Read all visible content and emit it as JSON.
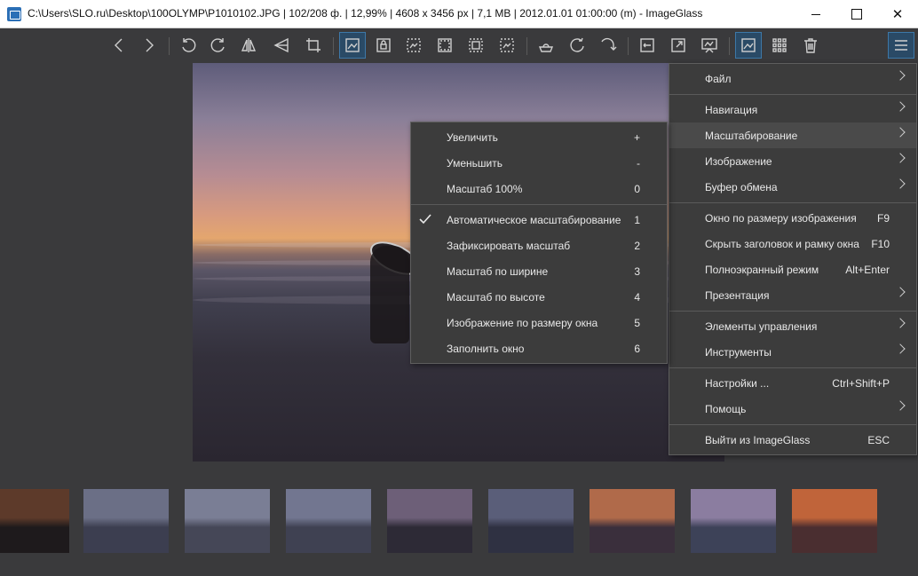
{
  "window": {
    "title": "C:\\Users\\SLO.ru\\Desktop\\100OLYMP\\P1010102.JPG  |  102/208 ф.  |  12,99%  |  4608 x 3456 px  |  7,1 MB  |  2012.01.01 01:00:00 (m)  - ImageGlass",
    "close_glyph": "✕"
  },
  "toolbar": {
    "buttons": [
      "previous-image",
      "next-image",
      "rotate-left",
      "rotate-right",
      "flip-horizontal",
      "flip-vertical",
      "crop",
      "auto-zoom",
      "lock-zoom",
      "scale-to-width",
      "scale-to-height",
      "scale-to-fit",
      "scale-to-fill",
      "open-with",
      "refresh",
      "goto",
      "window-fit",
      "fullscreen",
      "slideshow",
      "thumbnail-bar",
      "grid",
      "delete",
      "main-menu"
    ],
    "active": [
      "auto-zoom",
      "thumbnail-bar",
      "main-menu"
    ]
  },
  "main_menu": {
    "items": [
      {
        "label": "Файл",
        "submenu": true
      },
      {
        "sep": true
      },
      {
        "label": "Навигация",
        "submenu": true
      },
      {
        "label": "Масштабирование",
        "submenu": true,
        "hover": true
      },
      {
        "label": "Изображение",
        "submenu": true
      },
      {
        "label": "Буфер обмена",
        "submenu": true
      },
      {
        "sep": true
      },
      {
        "label": "Окно по размеру изображения",
        "shortcut": "F9"
      },
      {
        "label": "Скрыть заголовок и рамку окна",
        "shortcut": "F10"
      },
      {
        "label": "Полноэкранный режим",
        "shortcut": "Alt+Enter"
      },
      {
        "label": "Презентация",
        "submenu": true
      },
      {
        "sep": true
      },
      {
        "label": "Элементы управления",
        "submenu": true
      },
      {
        "label": "Инструменты",
        "submenu": true
      },
      {
        "sep": true
      },
      {
        "label": "Настройки ...",
        "shortcut": "Ctrl+Shift+P"
      },
      {
        "label": "Помощь",
        "submenu": true
      },
      {
        "sep": true
      },
      {
        "label": "Выйти из ImageGlass",
        "shortcut": "ESC"
      }
    ]
  },
  "zoom_menu": {
    "items": [
      {
        "label": "Увеличить",
        "shortcut": "+"
      },
      {
        "label": "Уменьшить",
        "shortcut": "-"
      },
      {
        "label": "Масштаб 100%",
        "shortcut": "0"
      },
      {
        "sep": true
      },
      {
        "label": "Автоматическое масштабирование",
        "shortcut": "1",
        "checked": true
      },
      {
        "label": "Зафиксировать масштаб",
        "shortcut": "2"
      },
      {
        "label": "Масштаб по ширине",
        "shortcut": "3"
      },
      {
        "label": "Масштаб по высоте",
        "shortcut": "4"
      },
      {
        "label": "Изображение по размеру окна",
        "shortcut": "5"
      },
      {
        "label": "Заполнить окно",
        "shortcut": "6"
      }
    ]
  },
  "thumbnails": {
    "count": 9,
    "colors": [
      [
        "#5d3a2a",
        "#1e1a1c"
      ],
      [
        "#6b6f86",
        "#3c3e50"
      ],
      [
        "#7a7e95",
        "#454757"
      ],
      [
        "#727690",
        "#3f4152"
      ],
      [
        "#6d5f78",
        "#2d2a36"
      ],
      [
        "#5a5e79",
        "#2f3142"
      ],
      [
        "#b06a4a",
        "#3a2f3c"
      ],
      [
        "#8b7da0",
        "#3d4258"
      ],
      [
        "#c0643a",
        "#4a2e30"
      ]
    ]
  }
}
